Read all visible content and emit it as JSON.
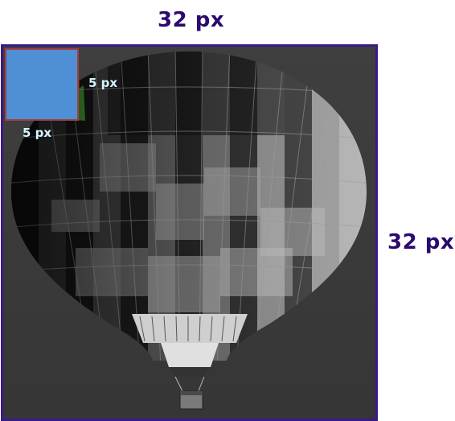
{
  "labels": {
    "image_width": "32 px",
    "image_height": "32 px",
    "patch_width": "5 px",
    "patch_height": "5 px"
  },
  "colors": {
    "label_text": "#2b0a6e",
    "frame_border": "#3a1a8a",
    "patch_fill": "#4f8fd6",
    "patch_border": "#a14040",
    "small_label_text": "#d6f4ff",
    "background": "#3c3c3c"
  },
  "figure": {
    "subject": "hot-air-balloon"
  }
}
